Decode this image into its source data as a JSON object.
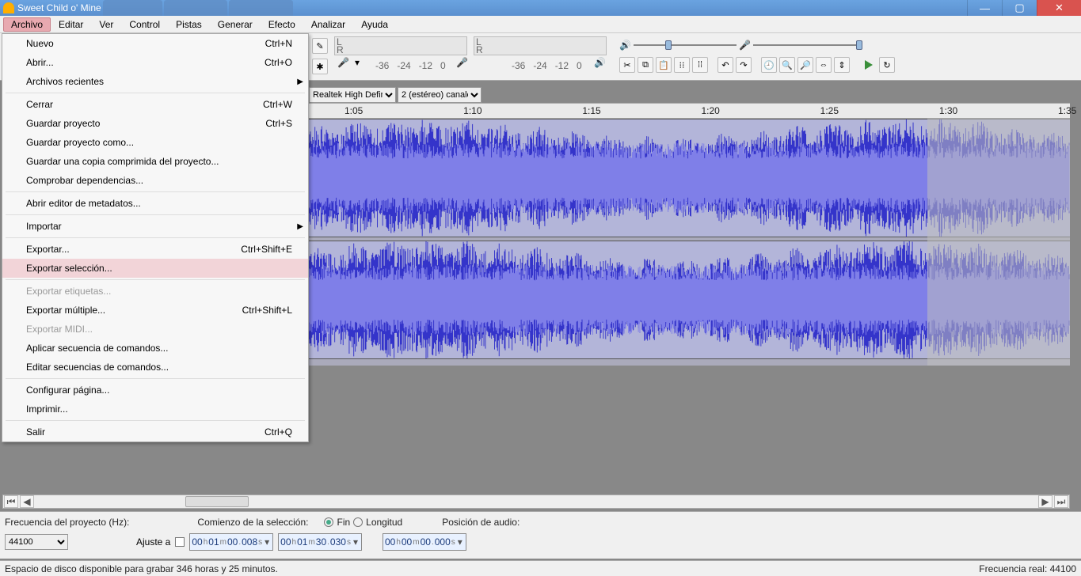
{
  "title": "Sweet Child o' Mine",
  "menubar": [
    "Archivo",
    "Editar",
    "Ver",
    "Control",
    "Pistas",
    "Generar",
    "Efecto",
    "Analizar",
    "Ayuda"
  ],
  "dropdown": [
    {
      "label": "Nuevo",
      "shortcut": "Ctrl+N"
    },
    {
      "label": "Abrir...",
      "shortcut": "Ctrl+O"
    },
    {
      "label": "Archivos recientes",
      "sub": true
    },
    {
      "sep": true
    },
    {
      "label": "Cerrar",
      "shortcut": "Ctrl+W"
    },
    {
      "label": "Guardar proyecto",
      "shortcut": "Ctrl+S"
    },
    {
      "label": "Guardar proyecto como..."
    },
    {
      "label": "Guardar una copia comprimida del proyecto..."
    },
    {
      "label": "Comprobar dependencias..."
    },
    {
      "sep": true
    },
    {
      "label": "Abrir editor de metadatos..."
    },
    {
      "sep": true
    },
    {
      "label": "Importar",
      "sub": true
    },
    {
      "sep": true
    },
    {
      "label": "Exportar...",
      "shortcut": "Ctrl+Shift+E"
    },
    {
      "label": "Exportar selección...",
      "hover": true
    },
    {
      "sep": true
    },
    {
      "label": "Exportar etiquetas...",
      "disabled": true
    },
    {
      "label": "Exportar múltiple...",
      "shortcut": "Ctrl+Shift+L"
    },
    {
      "label": "Exportar MIDI...",
      "disabled": true
    },
    {
      "label": "Aplicar secuencia de comandos..."
    },
    {
      "label": "Editar secuencias de comandos..."
    },
    {
      "sep": true
    },
    {
      "label": "Configurar página..."
    },
    {
      "label": "Imprimir..."
    },
    {
      "sep": true
    },
    {
      "label": "Salir",
      "shortcut": "Ctrl+Q"
    }
  ],
  "db_ticks": [
    "-36",
    "-24",
    "-12",
    "0"
  ],
  "device_host": "Realtek High Defini",
  "device_chan": "2 (estéreo) canale",
  "ruler_ticks": [
    "1:05",
    "1:10",
    "1:15",
    "1:20",
    "1:25",
    "1:30",
    "1:35"
  ],
  "bottom": {
    "freq_label": "Frecuencia del proyecto (Hz):",
    "freq_value": "44100",
    "sel_start_label": "Comienzo de la selección:",
    "fin": "Fin",
    "longitud": "Longitud",
    "audio_pos_label": "Posición de audio:",
    "ajuste": "Ajuste a",
    "t1": {
      "h": "00",
      "m": "01",
      "s": "00",
      "ms": "008"
    },
    "t2": {
      "h": "00",
      "m": "01",
      "s": "30",
      "ms": "030"
    },
    "t3": {
      "h": "00",
      "m": "00",
      "s": "00",
      "ms": "000"
    }
  },
  "status_left": "Espacio de disco disponible para grabar 346 horas y 25 minutos.",
  "status_right": "Frecuencia real: 44100"
}
